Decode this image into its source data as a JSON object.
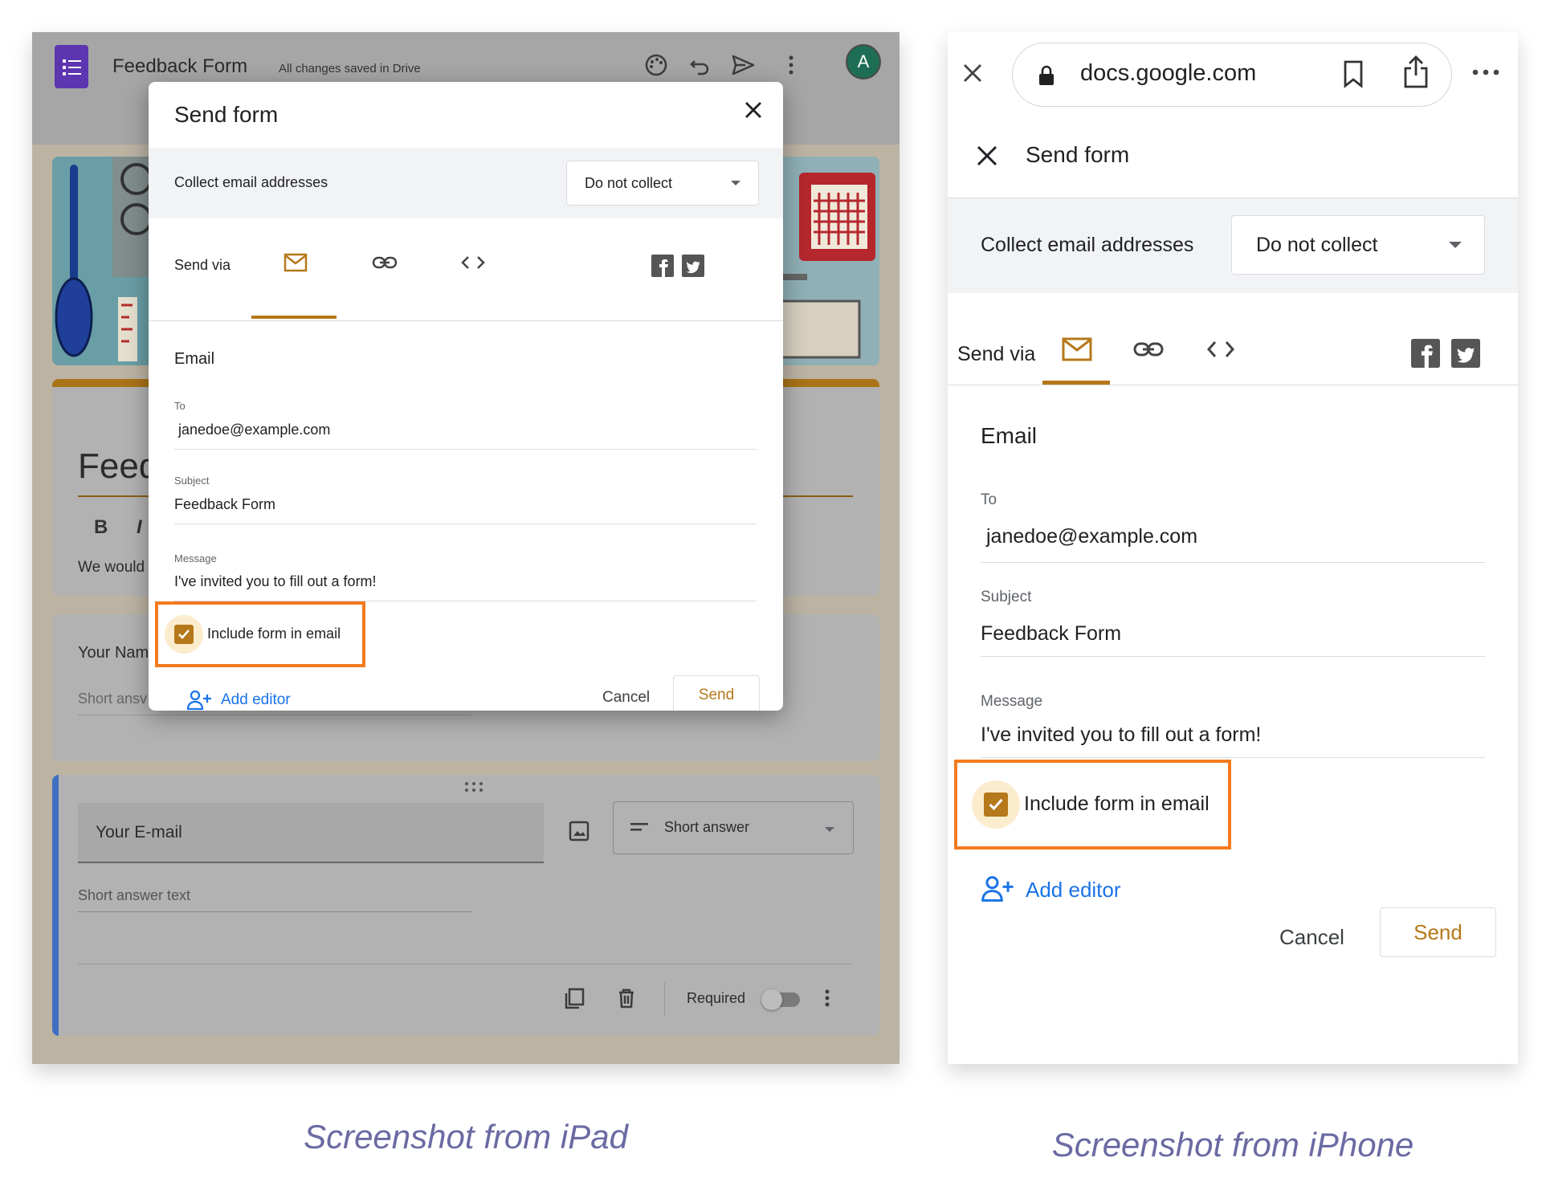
{
  "ipad": {
    "app_title": "Feedback Form",
    "saved_status": "All changes saved in Drive",
    "avatar_letter": "A",
    "form_title_partial": "Feed",
    "desc_partial": "We would",
    "your_name_partial": "Your Nam",
    "short_answer_partial": "Short ansv",
    "email_question": "Your E-mail",
    "question_type": "Short answer",
    "short_answer_text": "Short answer text",
    "required_label": "Required"
  },
  "dialog": {
    "title": "Send form",
    "collect_label": "Collect email addresses",
    "collect_value": "Do not collect",
    "send_via": "Send via",
    "section_title": "Email",
    "to_label": "To",
    "to_value": "janedoe@example.com",
    "subject_label": "Subject",
    "subject_value": "Feedback Form",
    "message_label": "Message",
    "message_value": "I've invited you to fill out a form!",
    "include_label": "Include form in email",
    "add_editor": "Add editor",
    "cancel": "Cancel",
    "send": "Send"
  },
  "iphone": {
    "url": "docs.google.com"
  },
  "captions": {
    "ipad": "Screenshot from iPad",
    "iphone": "Screenshot from iPhone"
  },
  "colors": {
    "accent": "#b5781a",
    "highlight": "#f47a1f",
    "link": "#1a73e8",
    "caption": "#6a6aa3"
  }
}
